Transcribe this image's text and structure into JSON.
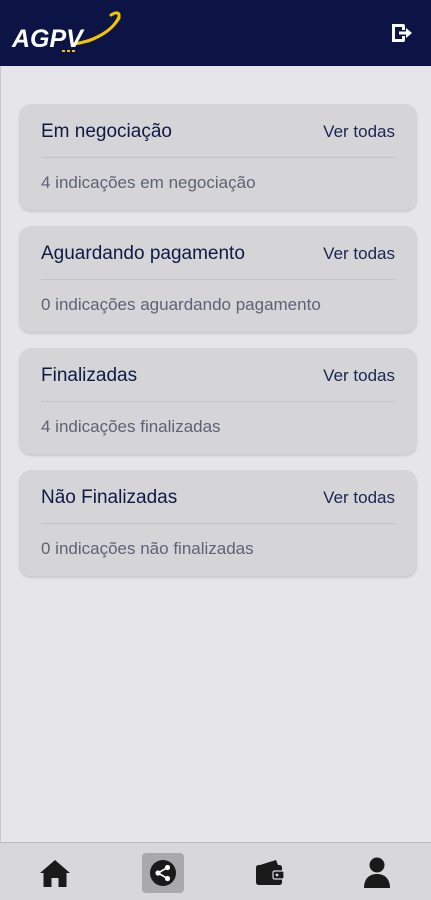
{
  "header": {
    "logo_text": "AGPV",
    "logo_icon": "agpv-logo",
    "logout_icon": "logout-icon"
  },
  "cards": [
    {
      "title": "Em negociação",
      "link": "Ver todas",
      "summary": "4 indicações em negociação"
    },
    {
      "title": "Aguardando pagamento",
      "link": "Ver todas",
      "summary": "0 indicações aguardando pagamento"
    },
    {
      "title": "Finalizadas",
      "link": "Ver todas",
      "summary": "4 indicações finalizadas"
    },
    {
      "title": "Não Finalizadas",
      "link": "Ver todas",
      "summary": "0 indicações não finalizadas"
    }
  ],
  "bottom_nav": {
    "items": [
      {
        "icon": "home-icon",
        "active": false
      },
      {
        "icon": "share-icon",
        "active": true
      },
      {
        "icon": "wallet-icon",
        "active": false
      },
      {
        "icon": "profile-icon",
        "active": false
      }
    ]
  },
  "colors": {
    "header_bg": "#0c1446",
    "logo_accent": "#f2c500",
    "page_bg": "#e6e6e8",
    "card_bg": "#d5d5d8",
    "nav_icon": "#1a1a1a"
  }
}
